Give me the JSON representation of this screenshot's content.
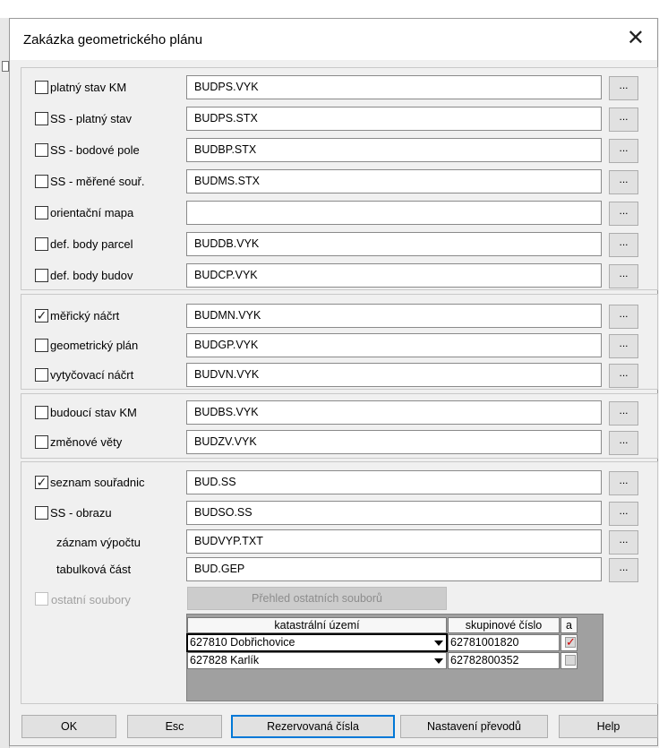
{
  "window": {
    "title": "Zakázka geometrického plánu",
    "close_glyph": "✕"
  },
  "groups": [
    {
      "rows": [
        {
          "checked": false,
          "label": "platný stav KM",
          "value": "BUDPS.VYK"
        },
        {
          "checked": false,
          "label": "SS - platný stav",
          "value": "BUDPS.STX"
        },
        {
          "checked": false,
          "label": "SS - bodové pole",
          "value": "BUDBP.STX"
        },
        {
          "checked": false,
          "label": "SS - měřené souř.",
          "value": "BUDMS.STX"
        },
        {
          "checked": false,
          "label": "orientační mapa",
          "value": ""
        },
        {
          "checked": false,
          "label": "def. body parcel",
          "value": "BUDDB.VYK"
        },
        {
          "checked": false,
          "label": "def. body budov",
          "value": "BUDCP.VYK"
        }
      ]
    },
    {
      "rows": [
        {
          "checked": true,
          "label": "měřický náčrt",
          "value": "BUDMN.VYK"
        },
        {
          "checked": false,
          "label": "geometrický plán",
          "value": "BUDGP.VYK"
        },
        {
          "checked": false,
          "label": "vytyčovací náčrt",
          "value": "BUDVN.VYK"
        }
      ]
    },
    {
      "rows": [
        {
          "checked": false,
          "label": "budoucí stav KM",
          "value": "BUDBS.VYK"
        },
        {
          "checked": false,
          "label": "změnové věty",
          "value": "BUDZV.VYK"
        }
      ]
    },
    {
      "rows": [
        {
          "checked": true,
          "label": "seznam souřadnic",
          "value": "BUD.SS"
        },
        {
          "checked": false,
          "label": "SS - obrazu",
          "value": "BUDSO.SS"
        },
        {
          "label": "záznam výpočtu",
          "value": "BUDVYP.TXT"
        },
        {
          "label": "tabulková část",
          "value": "BUD.GEP"
        }
      ],
      "other_files": {
        "label": "ostatní soubory",
        "button": "Přehled ostatních souborů"
      }
    }
  ],
  "browse_label": "...",
  "cadastral_table": {
    "headers": [
      "katastrální území",
      "skupinové číslo",
      "a"
    ],
    "rows": [
      {
        "territory": "627810 Dobřichovice",
        "group": "62781001820",
        "a": true
      },
      {
        "territory": "627828 Karlík",
        "group": "62782800352",
        "a": false
      }
    ]
  },
  "buttons": {
    "ok": "OK",
    "esc": "Esc",
    "reserved": "Rezervovaná čísla",
    "settings": "Nastavení převodů",
    "help": "Help"
  }
}
